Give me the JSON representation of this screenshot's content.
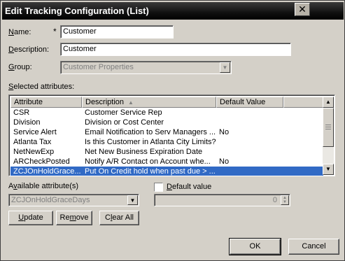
{
  "window": {
    "title": "Edit Tracking Configuration (List)",
    "close_glyph": "✕"
  },
  "form": {
    "name_label_pre": "",
    "name_label_ul": "N",
    "name_label_post": "ame:",
    "required_marker": "*",
    "name_value": "Customer",
    "description_label_ul": "D",
    "description_label_post": "escription:",
    "description_value": "Customer",
    "group_label_ul": "G",
    "group_label_post": "roup:",
    "group_value": "Customer Properties"
  },
  "selected_attributes": {
    "label_ul": "S",
    "label_post": "elected attributes:",
    "columns": [
      "Attribute",
      "Description",
      "Default Value"
    ],
    "rows": [
      {
        "attribute": "CSR",
        "description": "Customer Service Rep",
        "default": ""
      },
      {
        "attribute": "Division",
        "description": "Division or Cost Center",
        "default": ""
      },
      {
        "attribute": "Service Alert",
        "description": "Email Notification to Serv Managers ...",
        "default": "No"
      },
      {
        "attribute": "Atlanta Tax",
        "description": "Is this Customer in Atlanta City Limits?",
        "default": ""
      },
      {
        "attribute": "NetNewExp",
        "description": "Net New Business Expiration Date",
        "default": ""
      },
      {
        "attribute": "ARCheckPosted",
        "description": "Notify A/R Contact on Account whe...",
        "default": "No"
      },
      {
        "attribute": "ZCJOnHoldGrace...",
        "description": "Put On Credit hold when past due > ...",
        "default": ""
      }
    ],
    "selected_index": 6
  },
  "available": {
    "label_ul": "v",
    "label_pre": "A",
    "label_post": "ailable attribute(s)",
    "value": "ZCJOnHoldGraceDays",
    "default_checkbox_label_ul": "D",
    "default_checkbox_label_post": "efault value",
    "default_value": "0"
  },
  "buttons": {
    "update_ul": "U",
    "update_post": "pdate",
    "remove_pre": "Re",
    "remove_ul": "m",
    "remove_post": "ove",
    "clear_pre": "C",
    "clear_ul": "l",
    "clear_post": "ear All",
    "ok": "OK",
    "cancel": "Cancel"
  }
}
